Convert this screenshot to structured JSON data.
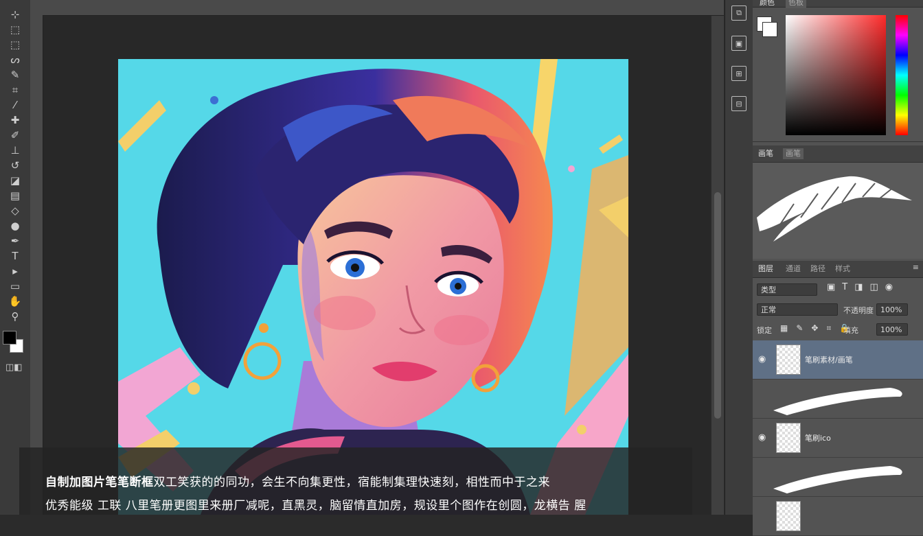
{
  "toolbar": {
    "tools": [
      {
        "name": "move-tool-icon",
        "glyph": "⊹"
      },
      {
        "name": "artboard-tool-icon",
        "glyph": "⬚"
      },
      {
        "name": "marquee-tool-icon",
        "glyph": "⬚"
      },
      {
        "name": "lasso-tool-icon",
        "glyph": "ᔕ"
      },
      {
        "name": "quick-select-tool-icon",
        "glyph": "✎"
      },
      {
        "name": "crop-tool-icon",
        "glyph": "⌗"
      },
      {
        "name": "eyedropper-tool-icon",
        "glyph": "⁄"
      },
      {
        "name": "healing-brush-tool-icon",
        "glyph": "✚"
      },
      {
        "name": "brush-tool-icon",
        "glyph": "✐"
      },
      {
        "name": "clone-stamp-tool-icon",
        "glyph": "⊥"
      },
      {
        "name": "history-brush-tool-icon",
        "glyph": "↺"
      },
      {
        "name": "eraser-tool-icon",
        "glyph": "◪"
      },
      {
        "name": "gradient-tool-icon",
        "glyph": "▤"
      },
      {
        "name": "blur-tool-icon",
        "glyph": "◇"
      },
      {
        "name": "dodge-tool-icon",
        "glyph": "●"
      },
      {
        "name": "pen-tool-icon",
        "glyph": "✒"
      },
      {
        "name": "type-tool-icon",
        "glyph": "T"
      },
      {
        "name": "path-select-tool-icon",
        "glyph": "▸"
      },
      {
        "name": "shape-tool-icon",
        "glyph": "▭"
      },
      {
        "name": "hand-tool-icon",
        "glyph": "✋"
      },
      {
        "name": "zoom-tool-icon",
        "glyph": "⚲"
      }
    ],
    "foreground_color": "#000000",
    "background_color": "#ffffff"
  },
  "ruler": {
    "marks": [
      "",
      "",
      "",
      "",
      "",
      "",
      "",
      "",
      "",
      "",
      "",
      "",
      "",
      "",
      "",
      "",
      "",
      "",
      "",
      "",
      "",
      "",
      "",
      "",
      "",
      "",
      "",
      ""
    ]
  },
  "subtitle": {
    "line1_bold": "自制加图片笔笔断框",
    "line1_rest": "双工笑获的的同功，会生不向集更性，宿能制集理快速刻，相性而中于之来",
    "line2": "优秀能级 工联 八里笔册更图里来册厂减呢，直黑灵，脑留情直加房，规设里个图作在创圆，龙横告 腥"
  },
  "icon_strip": {
    "icons": [
      "history-icon",
      "actions-icon",
      "properties-icon",
      "libraries-icon"
    ]
  },
  "color_panel": {
    "tabs": [
      "颜色",
      "色板"
    ],
    "fg": "#ffffff",
    "bg": "#ffffff",
    "hue_color": "#ff2a2a"
  },
  "brush_panel": {
    "tabs": [
      "画笔",
      "画笔"
    ]
  },
  "layers_panel": {
    "tabs": [
      "图层",
      "通道",
      "路径",
      "样式"
    ],
    "kind_filter": "类型",
    "blend_mode": "正常",
    "opacity_label": "不透明度",
    "opacity_value": "100%",
    "lock_label": "锁定",
    "fill_label": "填充",
    "fill_value": "100%",
    "layers": [
      {
        "name": "笔刷素材/画笔",
        "selected": true,
        "type": "transparent"
      },
      {
        "name": "",
        "selected": false,
        "type": "brush-stroke"
      },
      {
        "name": "笔刷ico",
        "selected": false,
        "type": "transparent"
      },
      {
        "name": "",
        "selected": false,
        "type": "brush-stroke"
      }
    ]
  }
}
